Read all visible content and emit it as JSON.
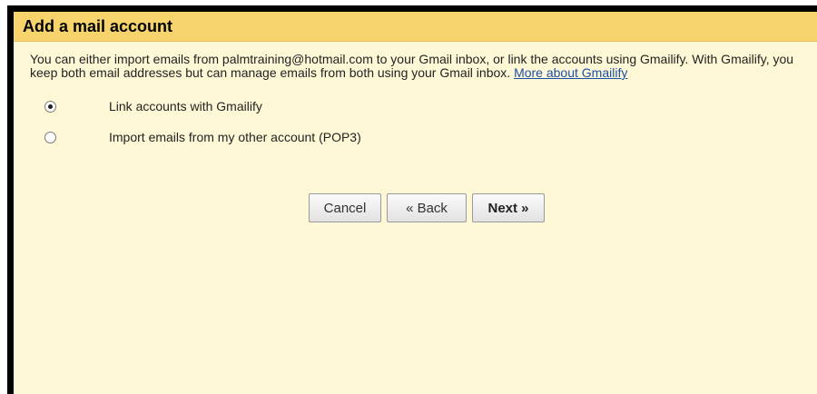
{
  "dialog": {
    "title": "Add a mail account",
    "description": "You can either import emails from palmtraining@hotmail.com to your Gmail inbox, or link the accounts using Gmailify. With Gmailify, you keep both email addresses but can manage emails from both using your Gmail inbox.",
    "more_link": "More about Gmailify"
  },
  "options": [
    {
      "label": "Link accounts with Gmailify",
      "selected": true
    },
    {
      "label": "Import emails from my other account (POP3)",
      "selected": false
    }
  ],
  "buttons": {
    "cancel": "Cancel",
    "back": "« Back",
    "next": "Next »"
  },
  "colors": {
    "title_bar": "#f7d46b",
    "panel_background": "#fff8d6",
    "link": "#1a4fa8"
  }
}
